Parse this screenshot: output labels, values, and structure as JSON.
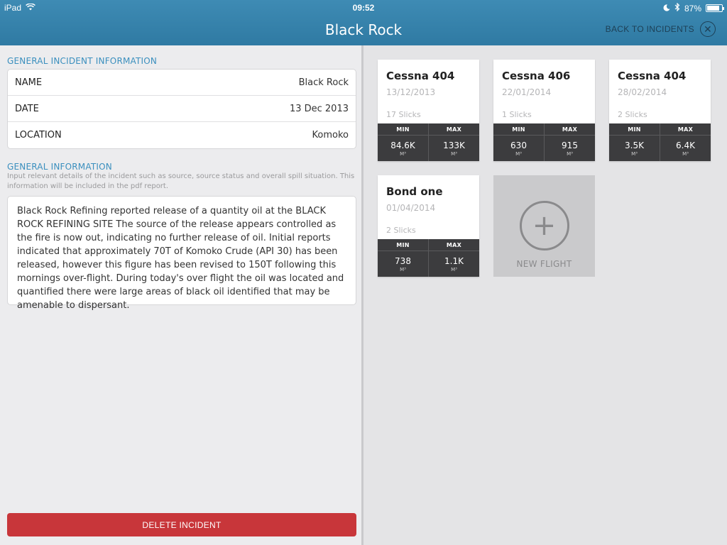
{
  "status_bar": {
    "device": "iPad",
    "time": "09:52",
    "battery": "87%",
    "battery_level": 0.87
  },
  "header": {
    "title": "Black Rock",
    "back_label": "BACK TO INCIDENTS"
  },
  "general_incident": {
    "section_title": "GENERAL INCIDENT INFORMATION",
    "rows": [
      {
        "label": "NAME",
        "value": "Black Rock"
      },
      {
        "label": "DATE",
        "value": "13 Dec 2013"
      },
      {
        "label": "LOCATION",
        "value": "Komoko"
      }
    ]
  },
  "general_info": {
    "section_title": "GENERAL INFORMATION",
    "helper_text": "Input relevant details of the incident such as source, source status and overall spill situation. This information will be included in the pdf report.",
    "body": "Black Rock Refining reported release of a quantity oil at the BLACK ROCK REFINING SITE The source of the release appears controlled as the fire is now out, indicating no further release of oil. Initial reports indicated that approximately 70T of Komoko Crude (API 30) has been released, however this figure has been revised to 150T following this mornings over-flight. During today's over flight the oil was located and quantified there were large areas of black oil identified that may be amenable to dispersant."
  },
  "delete_label": "DELETE INCIDENT",
  "flights": [
    {
      "title": "Cessna 404",
      "date": "13/12/2013",
      "slicks": "17 Slicks",
      "min_label": "MIN",
      "max_label": "MAX",
      "min": "84.6K",
      "max": "133K",
      "unit": "M³"
    },
    {
      "title": "Cessna 406",
      "date": "22/01/2014",
      "slicks": "1 Slicks",
      "min_label": "MIN",
      "max_label": "MAX",
      "min": "630",
      "max": "915",
      "unit": "M³"
    },
    {
      "title": "Cessna 404",
      "date": "28/02/2014",
      "slicks": "2 Slicks",
      "min_label": "MIN",
      "max_label": "MAX",
      "min": "3.5K",
      "max": "6.4K",
      "unit": "M³"
    },
    {
      "title": "Bond one",
      "date": "01/04/2014",
      "slicks": "2 Slicks",
      "min_label": "MIN",
      "max_label": "MAX",
      "min": "738",
      "max": "1.1K",
      "unit": "M³"
    }
  ],
  "new_flight_label": "NEW FLIGHT"
}
